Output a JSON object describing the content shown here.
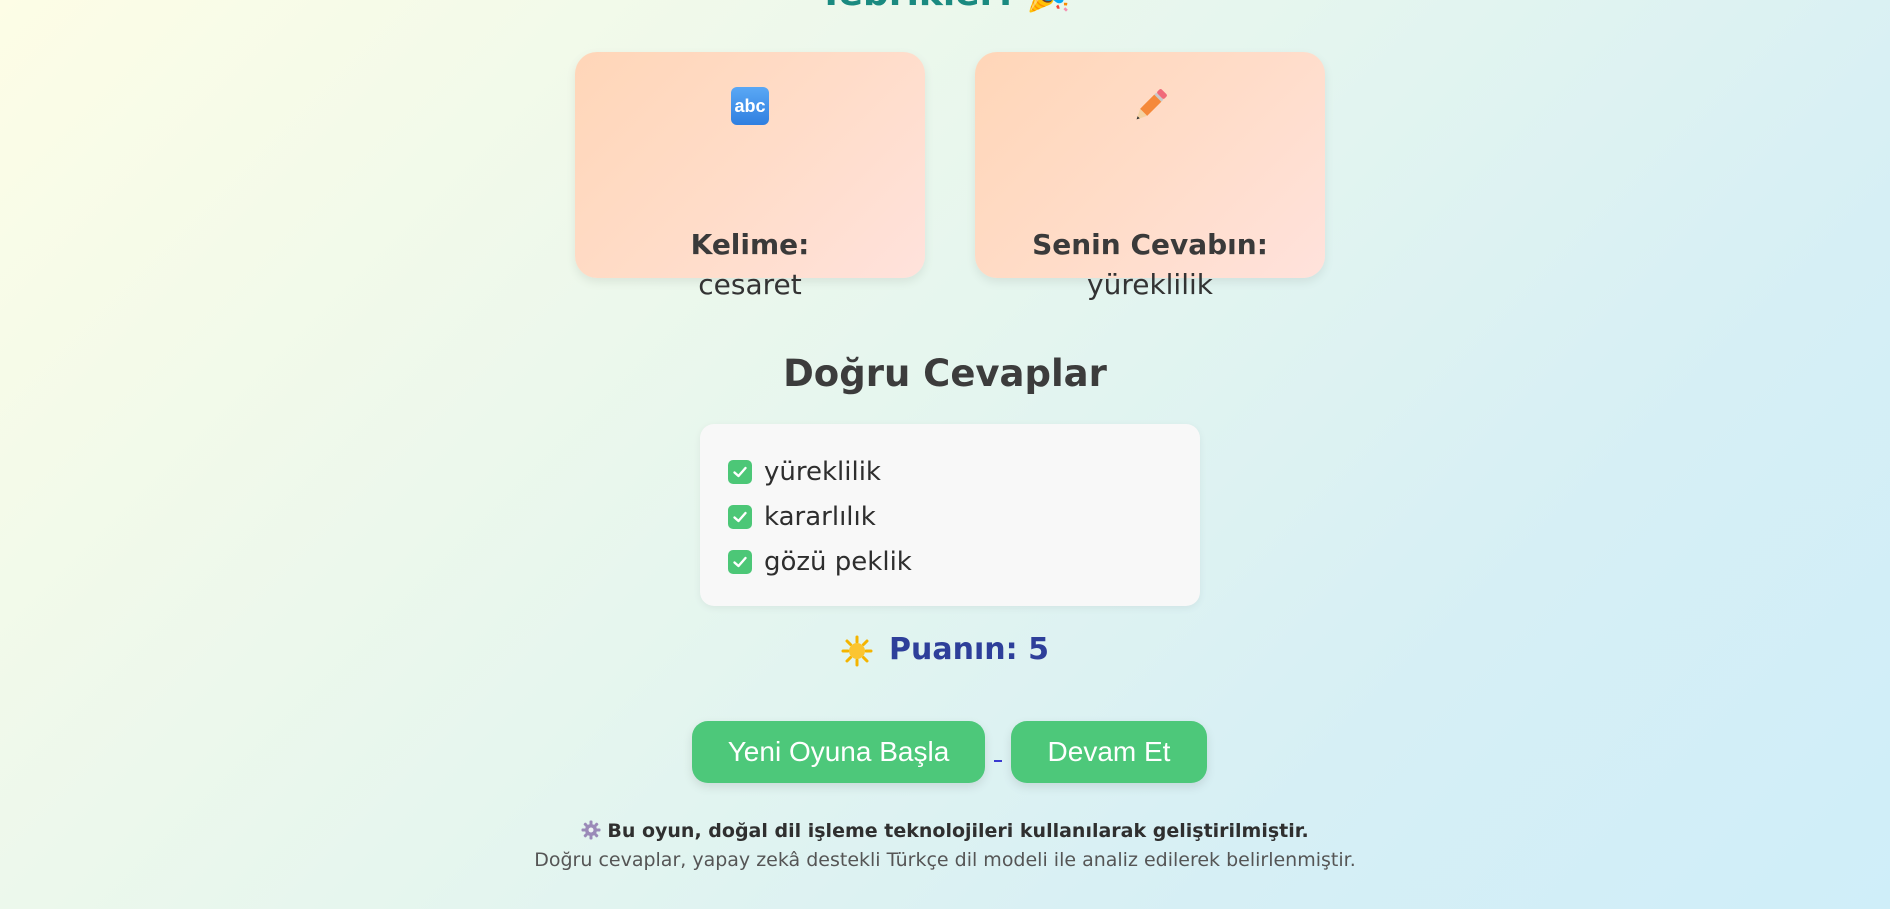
{
  "header": {
    "title": "Tebrikler! 🎉"
  },
  "cards": [
    {
      "icon": "abc-icon",
      "icon_text": "abc",
      "label": "Kelime:",
      "value": "cesaret"
    },
    {
      "icon": "pencil-icon",
      "label": "Senin Cevabın:",
      "value": "yüreklilik"
    }
  ],
  "correct": {
    "title": "Doğru Cevaplar",
    "items": [
      "yüreklilik",
      "kararlılık",
      "gözü peklik"
    ],
    "item_icon": "check-icon"
  },
  "score": {
    "icon": "sun-icon",
    "text": "Puanın: 5"
  },
  "buttons": {
    "new_game": "Yeni Oyuna Başla",
    "continue": "Devam Et"
  },
  "footer": {
    "icon": "gear-icon",
    "line1": "Bu oyun, doğal dil işleme teknolojileri kullanılarak geliştirilmiştir.",
    "line2": "Doğru cevaplar, yapay zekâ destekli Türkçe dil modeli ile analiz edilerek belirlenmiştir."
  },
  "colors": {
    "accent_green": "#4dc87a",
    "score_blue": "#2e3f9a",
    "title_teal": "#1a8a80"
  }
}
